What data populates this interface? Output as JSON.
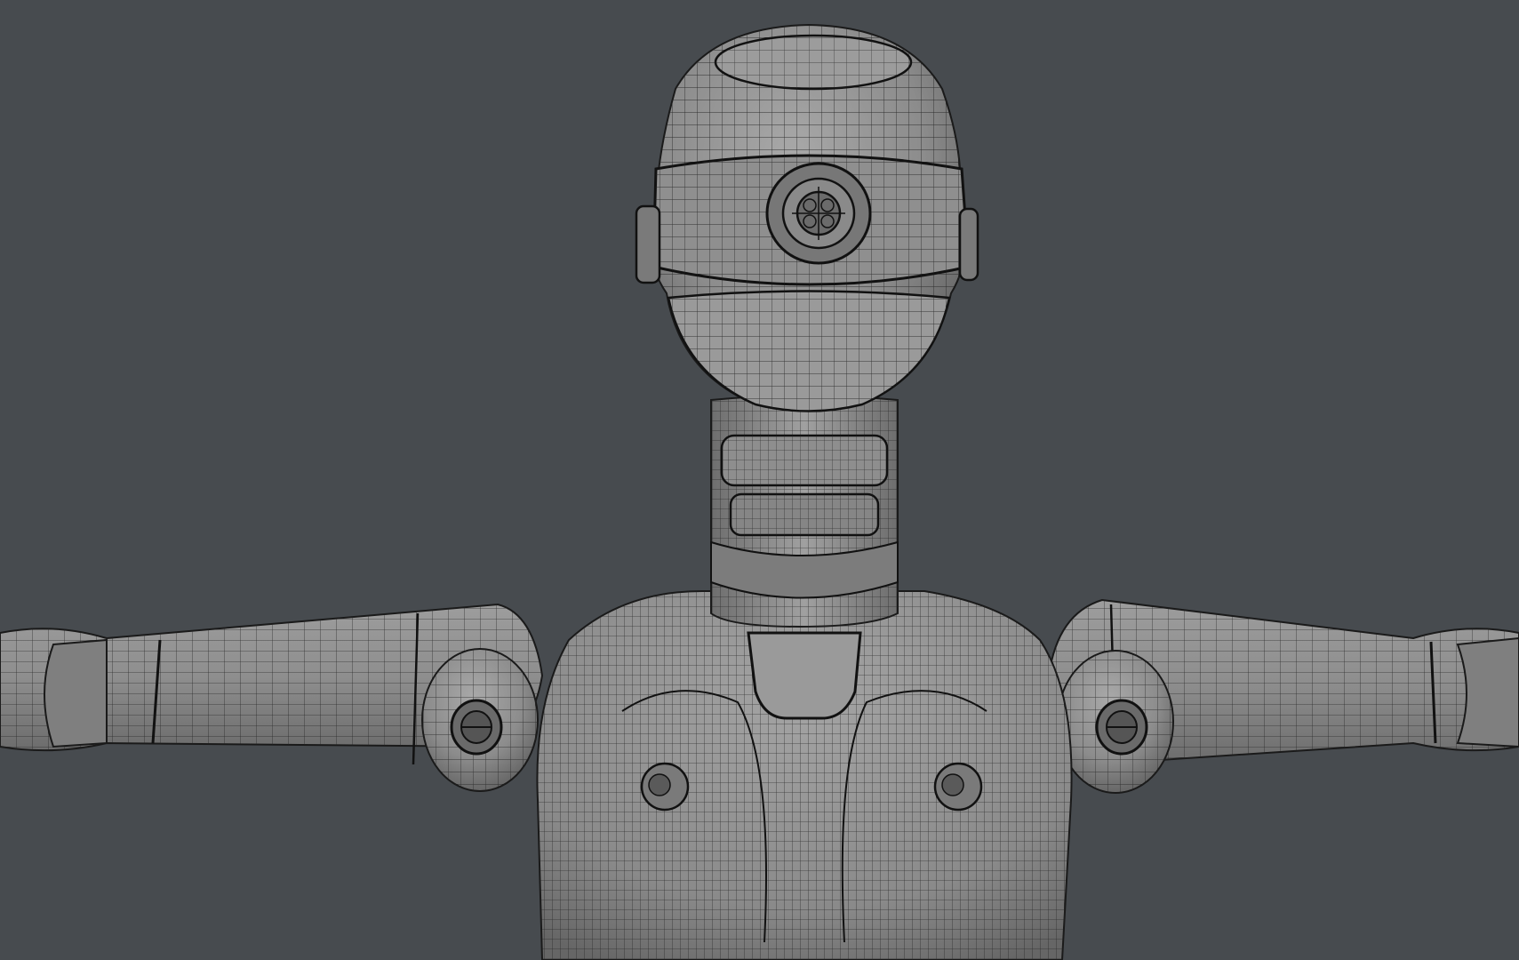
{
  "viewport": {
    "background": "#474b4f",
    "model": {
      "kind": "robot-mannequin",
      "shading": "grey-clay",
      "wireframe_overlay": true,
      "surface_color": "#8a8a8a",
      "wire_color": "#1e1e1e"
    }
  }
}
